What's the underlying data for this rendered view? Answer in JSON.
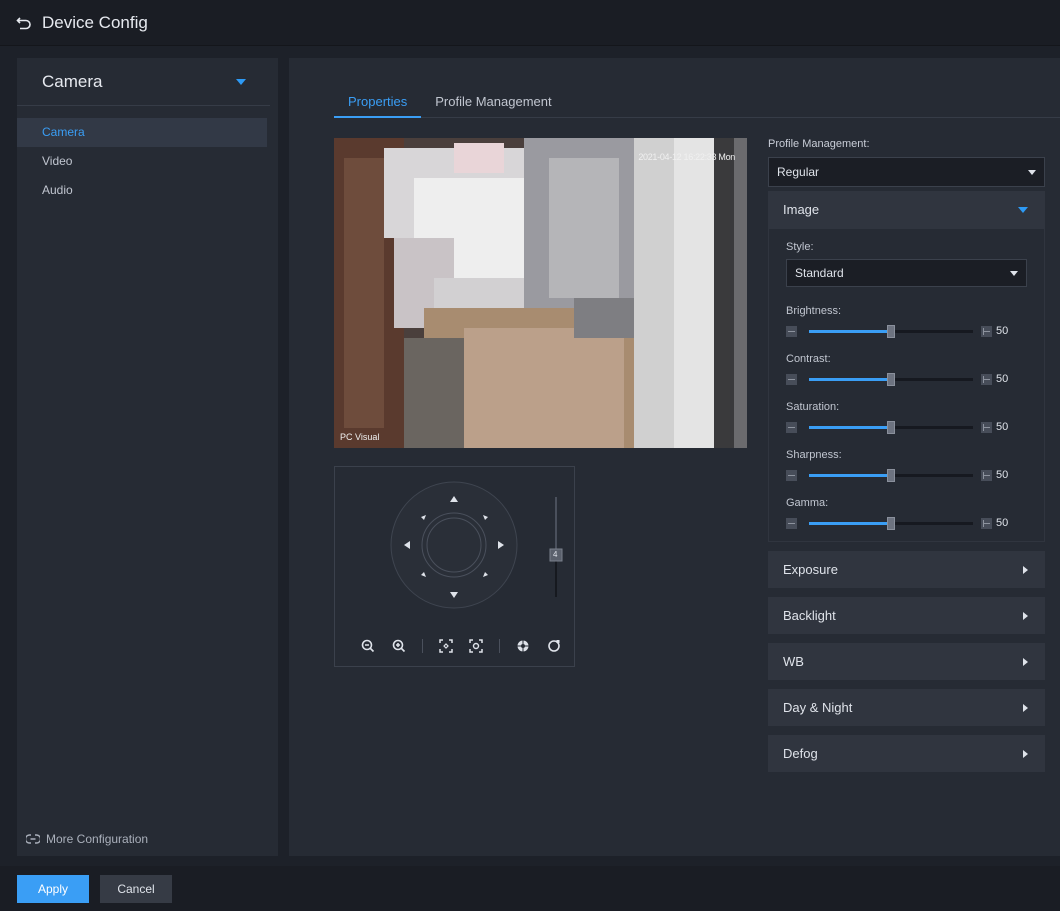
{
  "header": {
    "title": "Device Config"
  },
  "sidebar": {
    "title": "Camera",
    "items": [
      {
        "label": "Camera",
        "active": true
      },
      {
        "label": "Video",
        "active": false
      },
      {
        "label": "Audio",
        "active": false
      }
    ],
    "more": "More Configuration"
  },
  "tabs": [
    {
      "label": "Properties",
      "active": true
    },
    {
      "label": "Profile Management",
      "active": false
    }
  ],
  "video": {
    "timestamp": "2021-04-12 16:22:33 Mon",
    "label": "PC Visual"
  },
  "ptz": {
    "speed": "4",
    "tools": [
      "zoom-out-icon",
      "zoom-in-icon",
      "focus-near-icon",
      "focus-far-icon",
      "iris-icon",
      "refresh-icon"
    ]
  },
  "profile": {
    "label": "Profile Management:",
    "value": "Regular"
  },
  "image": {
    "title": "Image",
    "style_label": "Style:",
    "style_value": "Standard",
    "sliders": [
      {
        "label": "Brightness:",
        "value": 50
      },
      {
        "label": "Contrast:",
        "value": 50
      },
      {
        "label": "Saturation:",
        "value": 50
      },
      {
        "label": "Sharpness:",
        "value": 50
      },
      {
        "label": "Gamma:",
        "value": 50
      }
    ]
  },
  "sections": [
    "Exposure",
    "Backlight",
    "WB",
    "Day & Night",
    "Defog"
  ],
  "footer": {
    "apply": "Apply",
    "cancel": "Cancel"
  },
  "colors": {
    "accent": "#3a9ef5",
    "panel": "#262b34",
    "background": "#1d2129"
  }
}
